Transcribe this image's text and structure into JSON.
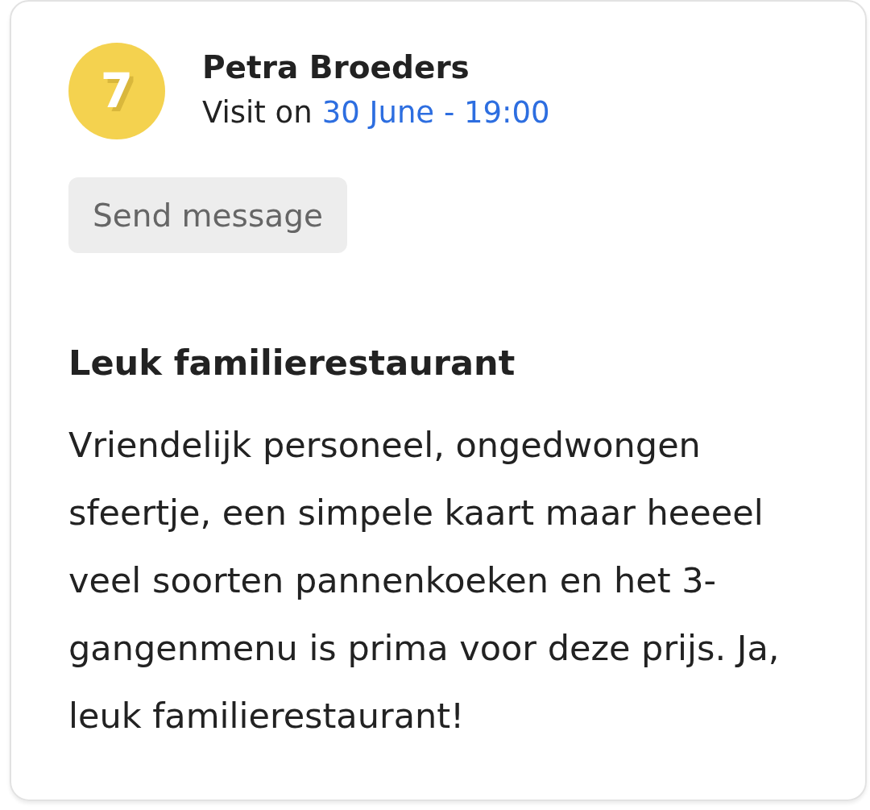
{
  "review": {
    "score": "7",
    "reviewer": "Petra Broeders",
    "visit_label": "Visit on",
    "visit_date": "30 June - 19:00",
    "button": "Send message",
    "title": "Leuk familierestaurant",
    "body": "Vriendelijk personeel, ongedwongen sfeertje, een simpele kaart maar heeeel veel soorten pannenkoeken en het 3-gangenmenu is prima voor deze prijs. Ja, leuk familierestaurant!"
  }
}
